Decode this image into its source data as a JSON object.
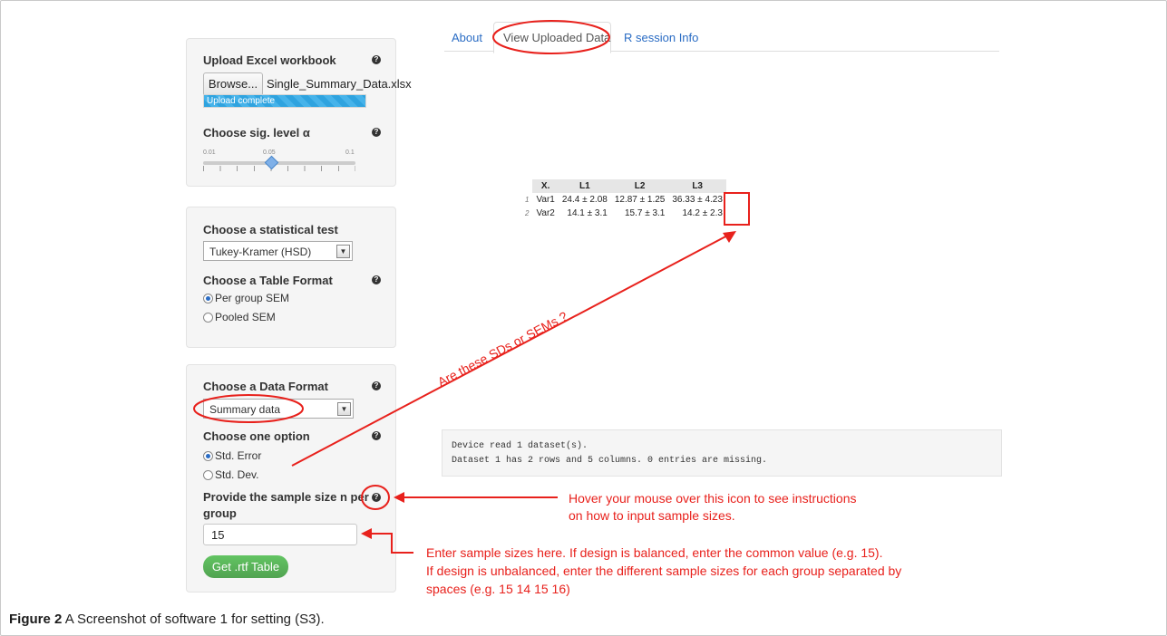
{
  "caption": {
    "label": "Figure 2",
    "text": " A Screenshot of software 1 for setting (S3)."
  },
  "upload_panel": {
    "title": "Upload Excel workbook",
    "browse_label": "Browse...",
    "filename": "Single_Summary_Data.xlsx",
    "progress_text": "Upload complete",
    "progress_fraction": 1.0
  },
  "sig_panel": {
    "title": "Choose sig. level α",
    "slider_min_label": "0.01",
    "slider_value_label": "0.05",
    "slider_max_label": "0.1",
    "slider_value": 0.05
  },
  "test_panel": {
    "title": "Choose a statistical test",
    "selected": "Tukey-Kramer (HSD)",
    "format_title": "Choose a Table Format",
    "options": [
      "Per group SEM",
      "Pooled SEM"
    ],
    "selected_option": "Per group SEM"
  },
  "data_panel": {
    "title": "Choose a Data Format",
    "selected": "Summary data",
    "option_title": "Choose one option",
    "options": [
      "Std. Error",
      "Std. Dev."
    ],
    "selected_option": "Std. Error",
    "sample_size_title_1": "Provide the sample size n per",
    "sample_size_title_2": "group",
    "sample_size_value": "15",
    "get_button": "Get .rtf Table"
  },
  "tabs": [
    "About",
    "View Uploaded Data",
    "R session Info"
  ],
  "active_tab": "View Uploaded Data",
  "chart_data": {
    "type": "table",
    "columns": [
      "X.",
      "L1",
      "L2",
      "L3"
    ],
    "rows": [
      {
        "index": "1",
        "cells": [
          "Var1",
          "24.4 ± 2.08",
          "12.87 ± 1.25",
          "36.33 ± 4.23"
        ]
      },
      {
        "index": "2",
        "cells": [
          "Var2",
          "14.1 ± 3.1",
          "15.7 ± 3.1",
          "14.2 ± 2.3"
        ]
      }
    ]
  },
  "console": {
    "line1": "Device read  1 dataset(s).",
    "line2": "Dataset 1 has 2 rows and 5 columns. 0 entries are missing."
  },
  "annotations": {
    "question": "Are these SDs or SEMs ?",
    "hover_1": "Hover your mouse over this icon to see instructions",
    "hover_2": "on how to input sample sizes.",
    "enter_1": "Enter sample sizes here. If design is balanced, enter the common value (e.g. 15).",
    "enter_2": "If design is unbalanced, enter the different sample sizes for each group separated by",
    "enter_3": "spaces (e.g. 15 14 15 16)"
  },
  "colors": {
    "annotation": "#e8211c",
    "link": "#2a6cc4",
    "button_green": "#5bb75b",
    "progress": "#2fa3df"
  }
}
